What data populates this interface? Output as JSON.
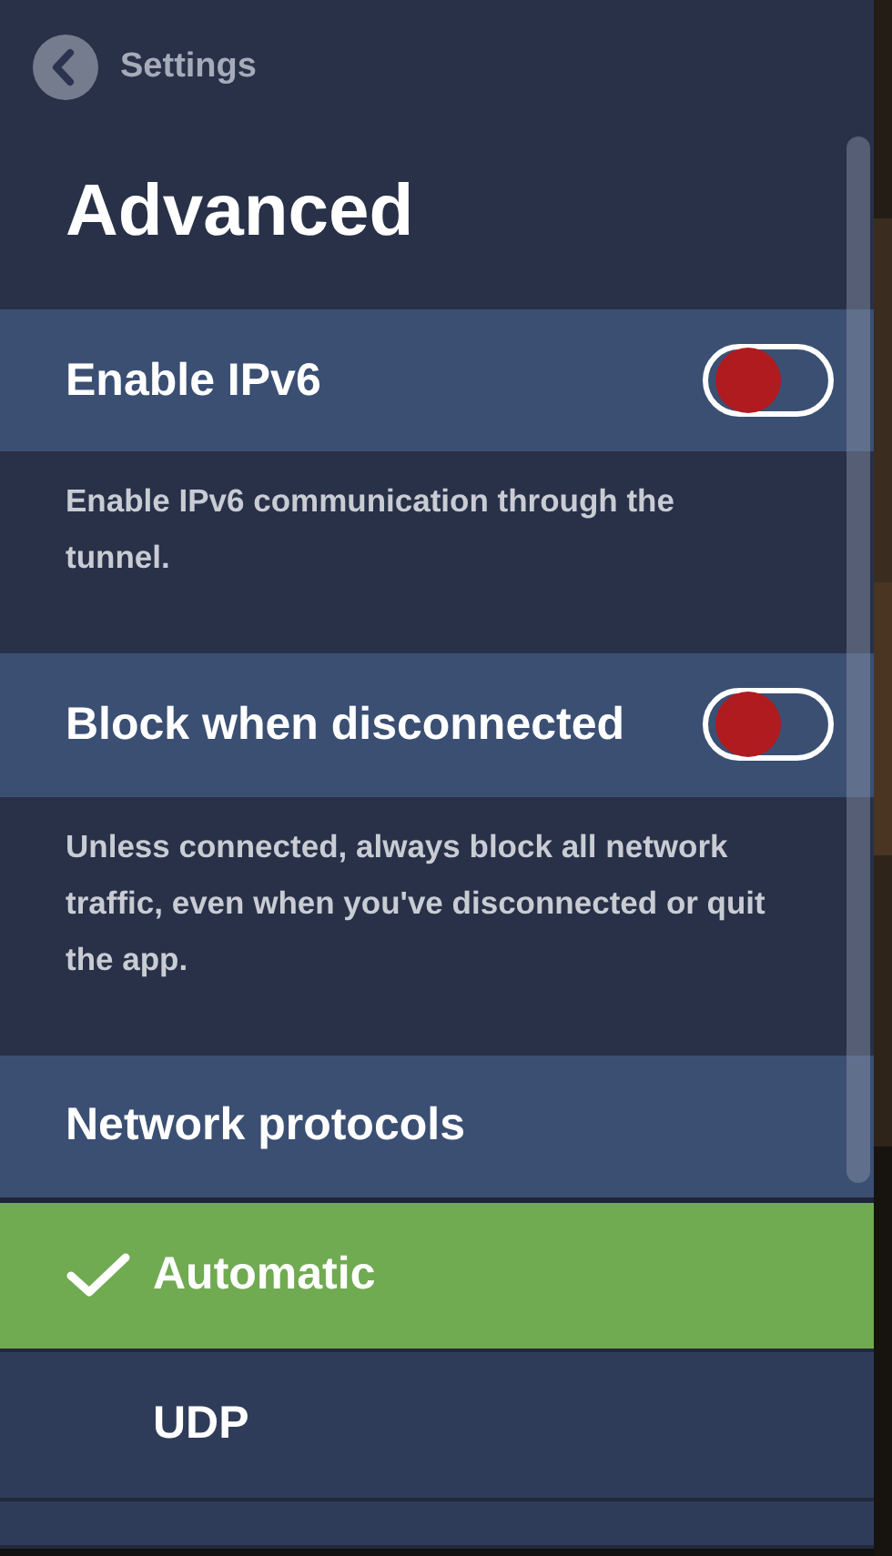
{
  "back": {
    "label": "Settings"
  },
  "title": "Advanced",
  "settings": [
    {
      "label": "Enable IPv6",
      "on": false,
      "description": "Enable IPv6 communication through the tunnel."
    },
    {
      "label": "Block when disconnected",
      "on": false,
      "description": "Unless connected, always block all network traffic, even when you've disconnected or quit the app."
    }
  ],
  "protocols": {
    "heading": "Network protocols",
    "options": [
      {
        "label": "Automatic",
        "selected": true
      },
      {
        "label": "UDP",
        "selected": false
      }
    ]
  }
}
